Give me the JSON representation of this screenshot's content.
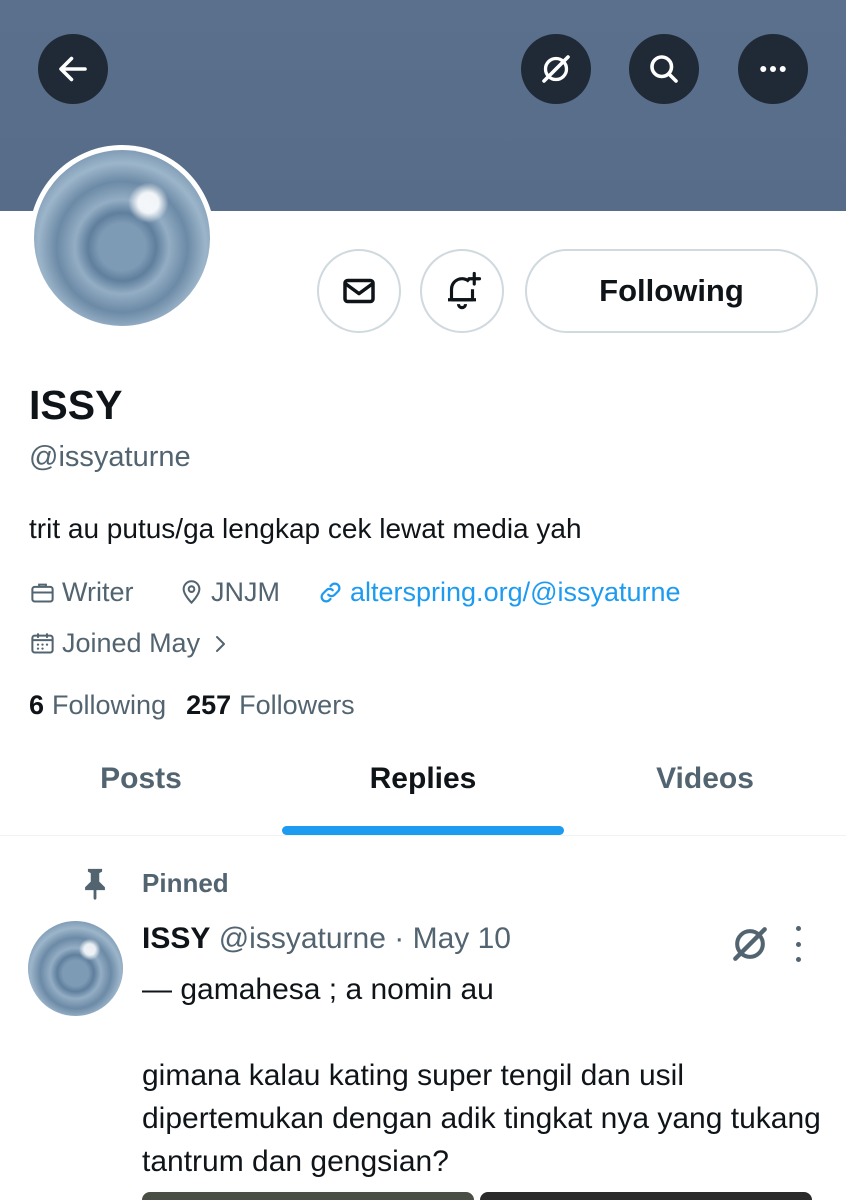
{
  "header": {
    "back_icon": "arrow-left-icon",
    "grok_icon": "grok-icon",
    "search_icon": "search-icon",
    "more_icon": "more-horizontal-icon"
  },
  "profile": {
    "name": "ISSY",
    "handle": "@issyaturne",
    "bio": "trit au putus/ga lengkap cek lewat media yah",
    "profession": "Writer",
    "location": "JNJM",
    "website": "alterspring.org/@issyaturne",
    "joined": "Joined May",
    "following_count": "6",
    "following_label": "Following",
    "followers_count": "257",
    "followers_label": "Followers"
  },
  "actions": {
    "follow_label": "Following",
    "message_icon": "envelope-icon",
    "notify_icon": "bell-plus-icon"
  },
  "tabs": [
    {
      "label": "Posts",
      "active": false
    },
    {
      "label": "Replies",
      "active": true
    },
    {
      "label": "Videos",
      "active": false
    }
  ],
  "pinned_post": {
    "pinned_label": "Pinned",
    "author_name": "ISSY",
    "author_handle": "@issyaturne",
    "separator": "·",
    "date": "May 10",
    "line1": "— gamahesa ; a nomin au",
    "line2": "gimana kalau kating super tengil dan usil dipertemukan dengan adik tingkat nya yang tukang tantrum dan gengsian?"
  },
  "colors": {
    "banner": "#566c88",
    "accent": "#1d9bf0",
    "secondary_text": "#536471"
  }
}
